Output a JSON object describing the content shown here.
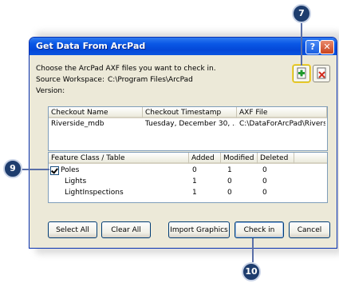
{
  "window": {
    "title": "Get Data From ArcPad",
    "help_glyph": "?",
    "close_glyph": "✕"
  },
  "info": {
    "prompt": "Choose the ArcPad AXF files you want to check in.",
    "source_label": "Source Workspace:",
    "source_value": "C:\\Program Files\\ArcPad",
    "version_label": "Version:"
  },
  "toolbar": {
    "add_icon": "add-file-icon",
    "remove_icon": "remove-file-icon"
  },
  "checkout_list": {
    "headers": [
      "Checkout Name",
      "Checkout Timestamp",
      "AXF File"
    ],
    "rows": [
      [
        "Riverside_mdb",
        "Tuesday, December 30, ...",
        "C:\\DataForArcPad\\Rivers..."
      ]
    ]
  },
  "feature_list": {
    "headers": [
      "Feature Class / Table",
      "Added",
      "Modified",
      "Deleted"
    ],
    "rows": [
      {
        "name": "Poles",
        "added": "0",
        "modified": "1",
        "deleted": "0",
        "checked": true
      },
      {
        "name": "Lights",
        "added": "1",
        "modified": "0",
        "deleted": "0"
      },
      {
        "name": "LightInspections",
        "added": "1",
        "modified": "0",
        "deleted": "0"
      }
    ]
  },
  "buttons": {
    "select_all": "Select All",
    "clear_all": "Clear All",
    "import_graphics": "Import Graphics",
    "check_in": "Check in",
    "cancel": "Cancel"
  },
  "callouts": {
    "c7": "7",
    "c9": "9",
    "c10": "10"
  },
  "colors": {
    "titlebar": "#0a58e6",
    "callout": "#1e3d6e"
  }
}
